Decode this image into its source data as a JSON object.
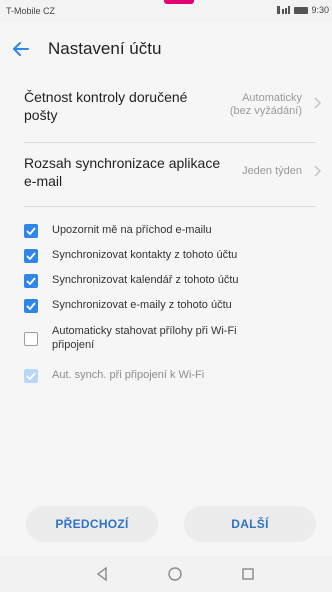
{
  "status_bar": {
    "carrier": "T-Mobile CZ",
    "time": "9:30",
    "indicators": "N ⁴ᴳ⁴ˡˡ"
  },
  "header": {
    "title": "Nastavení účtu"
  },
  "settings": [
    {
      "label": "Četnost kontroly doručené pošty",
      "value_line1": "Automaticky",
      "value_line2": "(bez vyžádání)"
    },
    {
      "label": "Rozsah synchronizace aplikace e-mail",
      "value_line1": "Jeden týden",
      "value_line2": ""
    }
  ],
  "checkboxes": [
    {
      "label": "Upozornit mě na příchod e-mailu",
      "checked": true,
      "enabled": true
    },
    {
      "label": "Synchronizovat kontakty z tohoto účtu",
      "checked": true,
      "enabled": true
    },
    {
      "label": "Synchronizovat kalendář z tohoto účtu",
      "checked": true,
      "enabled": true
    },
    {
      "label": "Synchronizovat e-maily z tohoto účtu",
      "checked": true,
      "enabled": true
    },
    {
      "label": "Automaticky stahovat přílohy při Wi-Fi připojení",
      "checked": false,
      "enabled": true
    },
    {
      "label": "Aut. synch. při připojení k Wi-Fi",
      "checked": true,
      "enabled": false
    }
  ],
  "buttons": {
    "previous": "PŘEDCHOZÍ",
    "next": "DALŠÍ"
  },
  "colors": {
    "accent": "#2f86e9",
    "brand": "#e20074",
    "button_text": "#2f73c9"
  }
}
